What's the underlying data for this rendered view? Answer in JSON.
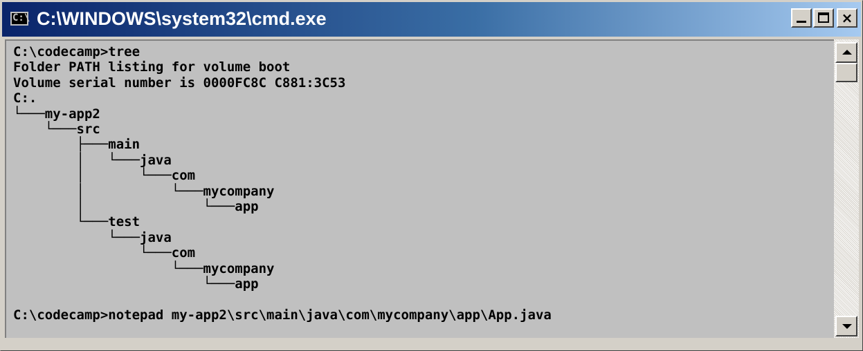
{
  "window": {
    "title": "C:\\WINDOWS\\system32\\cmd.exe",
    "icon": "cmd-icon",
    "icon_text": "C:\\",
    "controls": [
      "minimize-icon",
      "maximize-icon",
      "close-icon"
    ],
    "close_label": "×"
  },
  "console": {
    "lines": [
      "C:\\codecamp>tree",
      "Folder PATH listing for volume boot",
      "Volume serial number is 0000FC8C C881:3C53",
      "C:.",
      "└───my-app2",
      "    └───src",
      "        ├───main",
      "        │   └───java",
      "        │       └───com",
      "        │           └───mycompany",
      "        │               └───app",
      "        └───test",
      "            └───java",
      "                └───com",
      "                    └───mycompany",
      "                        └───app",
      "",
      "C:\\codecamp>notepad my-app2\\src\\main\\java\\com\\mycompany\\app\\App.java"
    ],
    "background": "#c0c0c0",
    "foreground": "#000000"
  }
}
